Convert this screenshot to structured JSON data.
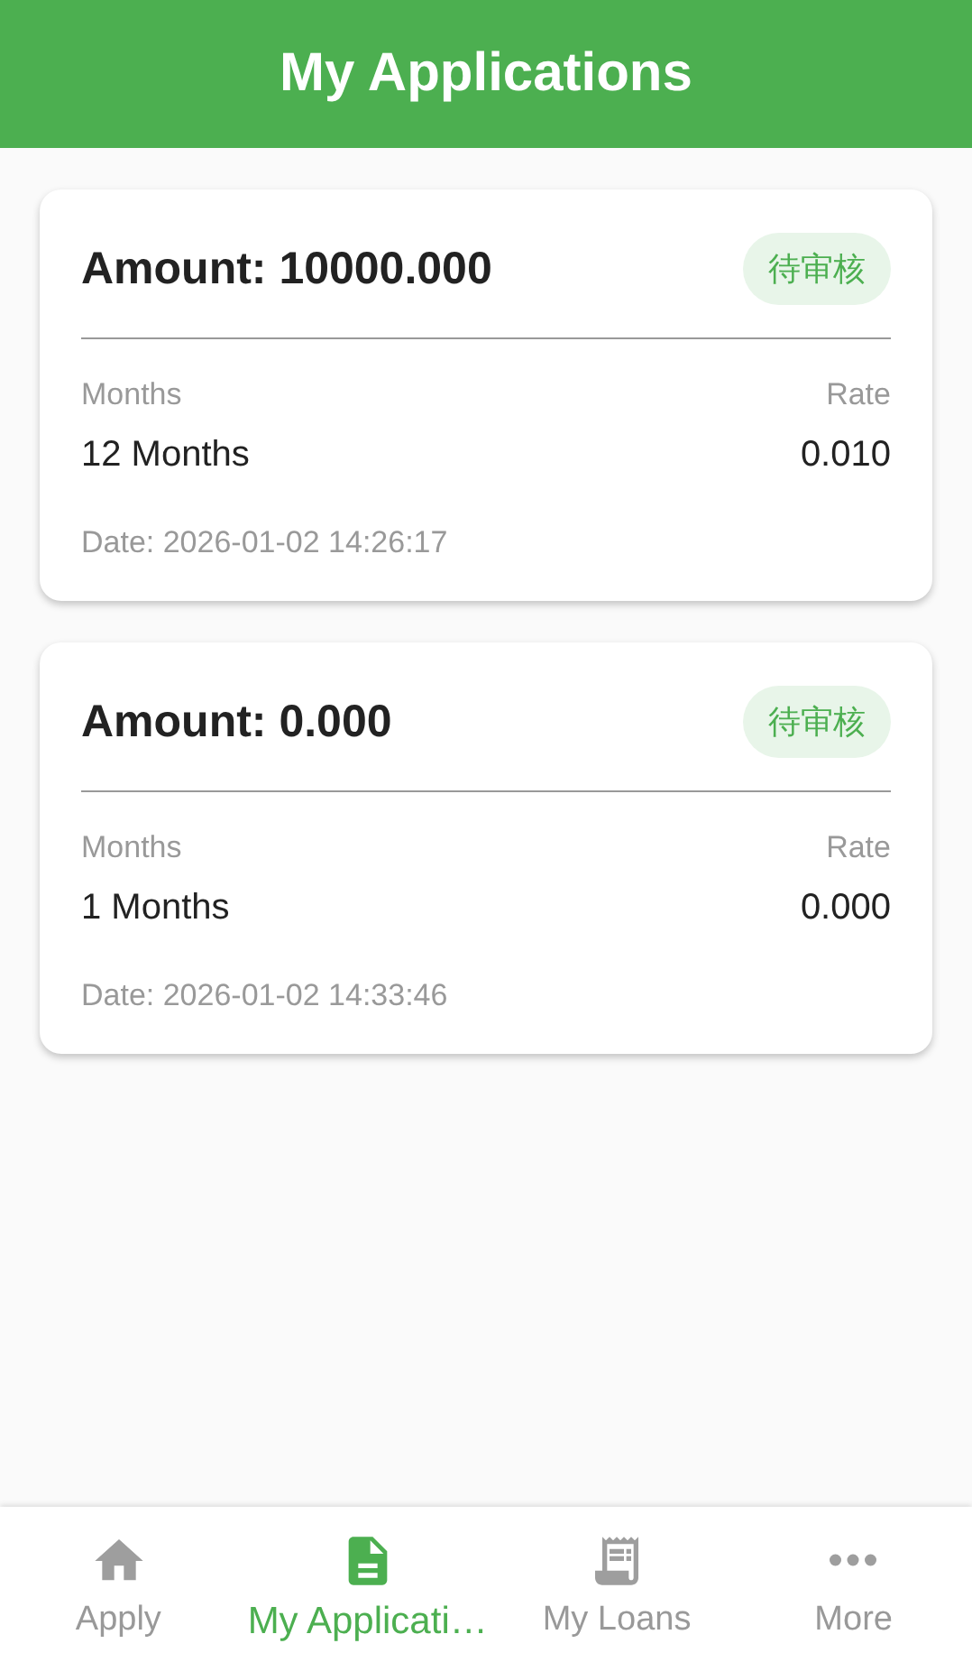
{
  "app_bar": {
    "title": "My Applications"
  },
  "applications": [
    {
      "amount": "Amount: 10000.000",
      "status": "待审核",
      "months_label": "Months",
      "rate_label": "Rate",
      "months": "12 Months",
      "rate": "0.010",
      "date": "Date: 2026-01-02 14:26:17"
    },
    {
      "amount": "Amount: 0.000",
      "status": "待审核",
      "months_label": "Months",
      "rate_label": "Rate",
      "months": "1 Months",
      "rate": "0.000",
      "date": "Date: 2026-01-02 14:33:46"
    }
  ],
  "bottom_nav": [
    {
      "label": "Apply",
      "kind": "home",
      "selected": false
    },
    {
      "label": "My Applicati…",
      "kind": "document",
      "selected": true
    },
    {
      "label": "My Loans",
      "kind": "receipt",
      "selected": false
    },
    {
      "label": "More",
      "kind": "more",
      "selected": false
    }
  ]
}
